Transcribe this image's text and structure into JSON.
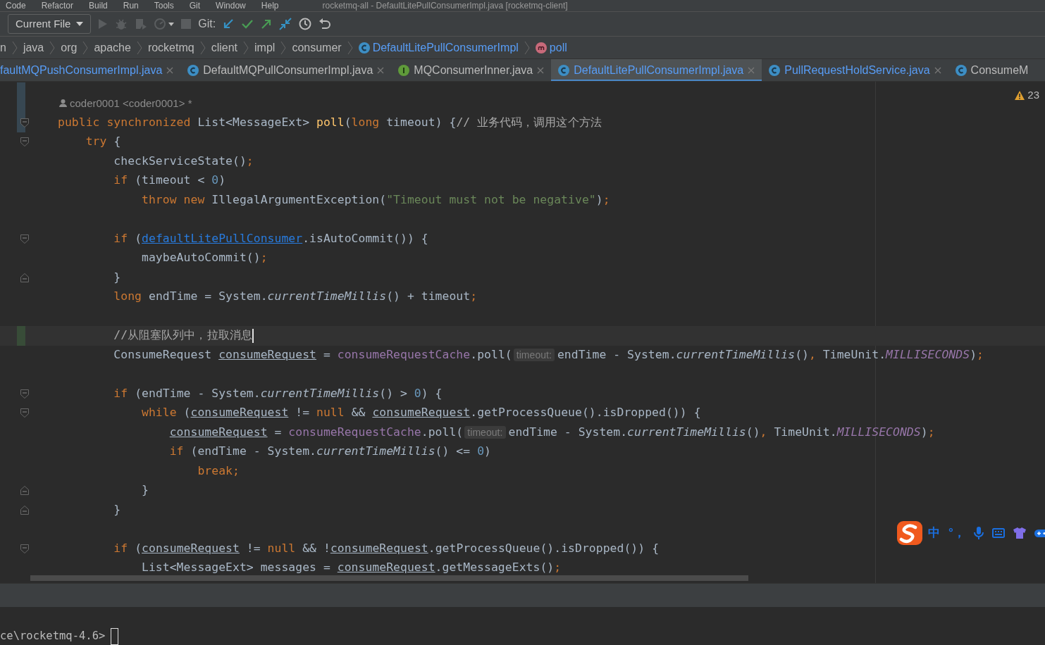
{
  "menu": [
    "Code",
    "Refactor",
    "Build",
    "Run",
    "Tools",
    "Git",
    "Window",
    "Help"
  ],
  "window": {
    "title": "rocketmq-all - DefaultLitePullConsumerImpl.java [rocketmq-client]"
  },
  "toolbar": {
    "run_config": "Current File",
    "git_label": "Git:"
  },
  "breadcrumbs": [
    {
      "label": "n",
      "kind": "folder"
    },
    {
      "label": "java",
      "kind": "folder"
    },
    {
      "label": "org",
      "kind": "folder"
    },
    {
      "label": "apache",
      "kind": "folder"
    },
    {
      "label": "rocketmq",
      "kind": "folder"
    },
    {
      "label": "client",
      "kind": "folder"
    },
    {
      "label": "impl",
      "kind": "folder"
    },
    {
      "label": "consumer",
      "kind": "folder"
    },
    {
      "label": "DefaultLitePullConsumerImpl",
      "kind": "class"
    },
    {
      "label": "poll",
      "kind": "method"
    }
  ],
  "tabs": [
    {
      "label": "faultMQPushConsumerImpl.java",
      "kind": "cut",
      "selected": false,
      "modified": true,
      "closable": true
    },
    {
      "label": "DefaultMQPullConsumerImpl.java",
      "kind": "class",
      "selected": false,
      "modified": false,
      "closable": true
    },
    {
      "label": "MQConsumerInner.java",
      "kind": "interface",
      "selected": false,
      "modified": false,
      "closable": true
    },
    {
      "label": "DefaultLitePullConsumerImpl.java",
      "kind": "class",
      "selected": true,
      "modified": true,
      "closable": true
    },
    {
      "label": "PullRequestHoldService.java",
      "kind": "class",
      "selected": false,
      "modified": true,
      "closable": true
    },
    {
      "label": "ConsumeM",
      "kind": "class",
      "selected": false,
      "modified": false,
      "closable": false
    }
  ],
  "editor": {
    "warnings": "23",
    "lines": [
      {
        "kind": "author",
        "text": "coder0001 <coder0001> *"
      },
      {
        "kind": "code",
        "fold_start": true,
        "modified": true,
        "tokens": [
          {
            "t": "public synchronized ",
            "kind": "keyword"
          },
          {
            "t": "List<MessageExt> ",
            "kind": "plain"
          },
          {
            "t": "poll",
            "kind": "method"
          },
          {
            "t": "(",
            "kind": "plain"
          },
          {
            "t": "long",
            "kind": "keyword"
          },
          {
            "t": " timeout) {",
            "kind": "plain"
          },
          {
            "t": "// 业务代码，调用这个方法",
            "kind": "comment"
          }
        ]
      },
      {
        "kind": "code",
        "fold_start": true,
        "tokens": [
          {
            "t": "    try",
            "kind": "keyword"
          },
          {
            "t": " {",
            "kind": "plain"
          }
        ]
      },
      {
        "kind": "code",
        "tokens": [
          {
            "t": "        checkServiceState()",
            "kind": "plain"
          },
          {
            "t": ";",
            "kind": "keyword"
          }
        ]
      },
      {
        "kind": "code",
        "tokens": [
          {
            "t": "        if",
            "kind": "keyword"
          },
          {
            "t": " (timeout < ",
            "kind": "plain"
          },
          {
            "t": "0",
            "kind": "number"
          },
          {
            "t": ")",
            "kind": "plain"
          }
        ]
      },
      {
        "kind": "code",
        "tokens": [
          {
            "t": "            throw new ",
            "kind": "keyword"
          },
          {
            "t": "IllegalArgumentException(",
            "kind": "plain"
          },
          {
            "t": "\"Timeout must not be negative\"",
            "kind": "string"
          },
          {
            "t": ")",
            "kind": "plain"
          },
          {
            "t": ";",
            "kind": "keyword"
          }
        ]
      },
      {
        "kind": "blank"
      },
      {
        "kind": "code",
        "fold_start": true,
        "tokens": [
          {
            "t": "        if",
            "kind": "keyword"
          },
          {
            "t": " (",
            "kind": "plain"
          },
          {
            "t": "defaultLitePullConsumer",
            "kind": "link"
          },
          {
            "t": ".isAutoCommit()) {",
            "kind": "plain"
          }
        ]
      },
      {
        "kind": "code",
        "tokens": [
          {
            "t": "            maybeAutoCommit()",
            "kind": "plain"
          },
          {
            "t": ";",
            "kind": "keyword"
          }
        ]
      },
      {
        "kind": "code",
        "fold_end": true,
        "tokens": [
          {
            "t": "        }",
            "kind": "plain"
          }
        ]
      },
      {
        "kind": "code",
        "tokens": [
          {
            "t": "        long",
            "kind": "keyword"
          },
          {
            "t": " endTime = System.",
            "kind": "plain"
          },
          {
            "t": "currentTimeMillis",
            "kind": "static"
          },
          {
            "t": "() + timeout",
            "kind": "plain"
          },
          {
            "t": ";",
            "kind": "keyword"
          }
        ]
      },
      {
        "kind": "blank"
      },
      {
        "kind": "code",
        "current": true,
        "caret": true,
        "added": true,
        "tokens": [
          {
            "t": "        //从阻塞队列中，拉取消息",
            "kind": "comment"
          }
        ]
      },
      {
        "kind": "code",
        "tokens": [
          {
            "t": "        ConsumeRequest ",
            "kind": "plain"
          },
          {
            "t": "consumeRequest",
            "kind": "variable"
          },
          {
            "t": " = ",
            "kind": "plain"
          },
          {
            "t": "consumeRequestCache",
            "kind": "field"
          },
          {
            "t": ".poll(",
            "kind": "plain"
          },
          {
            "t": "timeout:",
            "kind": "hint"
          },
          {
            "t": "endTime - System.",
            "kind": "plain"
          },
          {
            "t": "currentTimeMillis",
            "kind": "static"
          },
          {
            "t": "()",
            "kind": "plain"
          },
          {
            "t": ", ",
            "kind": "keyword"
          },
          {
            "t": "TimeUnit.",
            "kind": "plain"
          },
          {
            "t": "MILLISECONDS",
            "kind": "constant"
          },
          {
            "t": ")",
            "kind": "plain"
          },
          {
            "t": ";",
            "kind": "keyword"
          }
        ]
      },
      {
        "kind": "blank"
      },
      {
        "kind": "code",
        "fold_start": true,
        "tokens": [
          {
            "t": "        if",
            "kind": "keyword"
          },
          {
            "t": " (endTime - System.",
            "kind": "plain"
          },
          {
            "t": "currentTimeMillis",
            "kind": "static"
          },
          {
            "t": "() > ",
            "kind": "plain"
          },
          {
            "t": "0",
            "kind": "number"
          },
          {
            "t": ") {",
            "kind": "plain"
          }
        ]
      },
      {
        "kind": "code",
        "fold_start": true,
        "tokens": [
          {
            "t": "            while",
            "kind": "keyword"
          },
          {
            "t": " (",
            "kind": "plain"
          },
          {
            "t": "consumeRequest",
            "kind": "variable"
          },
          {
            "t": " != ",
            "kind": "plain"
          },
          {
            "t": "null",
            "kind": "keyword"
          },
          {
            "t": " && ",
            "kind": "plain"
          },
          {
            "t": "consumeRequest",
            "kind": "variable"
          },
          {
            "t": ".getProcessQueue().isDropped()) {",
            "kind": "plain"
          }
        ]
      },
      {
        "kind": "code",
        "tokens": [
          {
            "t": "                consumeRequest",
            "kind": "variable"
          },
          {
            "t": " = ",
            "kind": "plain"
          },
          {
            "t": "consumeRequestCache",
            "kind": "field"
          },
          {
            "t": ".poll(",
            "kind": "plain"
          },
          {
            "t": "timeout:",
            "kind": "hint"
          },
          {
            "t": "endTime - System.",
            "kind": "plain"
          },
          {
            "t": "currentTimeMillis",
            "kind": "static"
          },
          {
            "t": "()",
            "kind": "plain"
          },
          {
            "t": ", ",
            "kind": "keyword"
          },
          {
            "t": "TimeUnit.",
            "kind": "plain"
          },
          {
            "t": "MILLISECONDS",
            "kind": "constant"
          },
          {
            "t": ")",
            "kind": "plain"
          },
          {
            "t": ";",
            "kind": "keyword"
          }
        ]
      },
      {
        "kind": "code",
        "tokens": [
          {
            "t": "                if",
            "kind": "keyword"
          },
          {
            "t": " (endTime - System.",
            "kind": "plain"
          },
          {
            "t": "currentTimeMillis",
            "kind": "static"
          },
          {
            "t": "() <= ",
            "kind": "plain"
          },
          {
            "t": "0",
            "kind": "number"
          },
          {
            "t": ")",
            "kind": "plain"
          }
        ]
      },
      {
        "kind": "code",
        "tokens": [
          {
            "t": "                    break;",
            "kind": "keyword"
          }
        ]
      },
      {
        "kind": "code",
        "fold_end": true,
        "tokens": [
          {
            "t": "            }",
            "kind": "plain"
          }
        ]
      },
      {
        "kind": "code",
        "fold_end": true,
        "tokens": [
          {
            "t": "        }",
            "kind": "plain"
          }
        ]
      },
      {
        "kind": "blank"
      },
      {
        "kind": "code",
        "fold_start": true,
        "tokens": [
          {
            "t": "        if",
            "kind": "keyword"
          },
          {
            "t": " (",
            "kind": "plain"
          },
          {
            "t": "consumeRequest",
            "kind": "variable"
          },
          {
            "t": " != ",
            "kind": "plain"
          },
          {
            "t": "null",
            "kind": "keyword"
          },
          {
            "t": " && !",
            "kind": "plain"
          },
          {
            "t": "consumeRequest",
            "kind": "variable"
          },
          {
            "t": ".getProcessQueue().isDropped()) {",
            "kind": "plain"
          }
        ]
      },
      {
        "kind": "code",
        "tokens": [
          {
            "t": "            List<MessageExt> messages = ",
            "kind": "plain"
          },
          {
            "t": "consumeRequest",
            "kind": "variable"
          },
          {
            "t": ".getMessageExts()",
            "kind": "plain"
          },
          {
            "t": ";",
            "kind": "keyword"
          }
        ]
      }
    ]
  },
  "ime": {
    "mode": "中",
    "punct": "°，"
  },
  "terminal": {
    "prompt": "ce\\rocketmq-4.6>"
  }
}
